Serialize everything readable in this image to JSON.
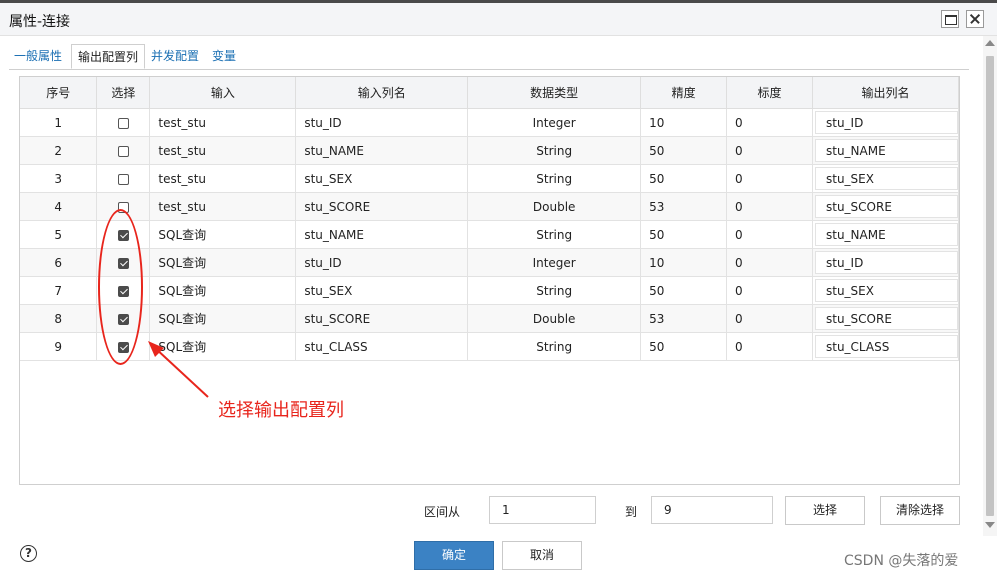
{
  "window": {
    "title": "属性-连接"
  },
  "tabs": [
    {
      "label": "一般属性",
      "active": false
    },
    {
      "label": "输出配置列",
      "active": true
    },
    {
      "label": "并发配置",
      "active": false
    },
    {
      "label": "变量",
      "active": false
    }
  ],
  "table": {
    "headers": [
      "序号",
      "选择",
      "输入",
      "输入列名",
      "数据类型",
      "精度",
      "标度",
      "输出列名"
    ],
    "rows": [
      {
        "no": "1",
        "checked": false,
        "input": "test_stu",
        "col": "stu_ID",
        "type": "Integer",
        "precision": "10",
        "scale": "0",
        "out": "stu_ID"
      },
      {
        "no": "2",
        "checked": false,
        "input": "test_stu",
        "col": "stu_NAME",
        "type": "String",
        "precision": "50",
        "scale": "0",
        "out": "stu_NAME"
      },
      {
        "no": "3",
        "checked": false,
        "input": "test_stu",
        "col": "stu_SEX",
        "type": "String",
        "precision": "50",
        "scale": "0",
        "out": "stu_SEX"
      },
      {
        "no": "4",
        "checked": false,
        "input": "test_stu",
        "col": "stu_SCORE",
        "type": "Double",
        "precision": "53",
        "scale": "0",
        "out": "stu_SCORE"
      },
      {
        "no": "5",
        "checked": true,
        "input": "SQL查询",
        "col": "stu_NAME",
        "type": "String",
        "precision": "50",
        "scale": "0",
        "out": "stu_NAME"
      },
      {
        "no": "6",
        "checked": true,
        "input": "SQL查询",
        "col": "stu_ID",
        "type": "Integer",
        "precision": "10",
        "scale": "0",
        "out": "stu_ID"
      },
      {
        "no": "7",
        "checked": true,
        "input": "SQL查询",
        "col": "stu_SEX",
        "type": "String",
        "precision": "50",
        "scale": "0",
        "out": "stu_SEX"
      },
      {
        "no": "8",
        "checked": true,
        "input": "SQL查询",
        "col": "stu_SCORE",
        "type": "Double",
        "precision": "53",
        "scale": "0",
        "out": "stu_SCORE"
      },
      {
        "no": "9",
        "checked": true,
        "input": "SQL查询",
        "col": "stu_CLASS",
        "type": "String",
        "precision": "50",
        "scale": "0",
        "out": "stu_CLASS"
      }
    ]
  },
  "annotation": {
    "text": "选择输出配置列",
    "color": "#e8251c"
  },
  "range": {
    "from_label": "区间从",
    "from_value": "1",
    "to_label": "到",
    "to_value": "9",
    "select_label": "选择",
    "clear_label": "清除选择"
  },
  "footer": {
    "ok_label": "确定",
    "cancel_label": "取消",
    "help_icon": "?",
    "watermark": "CSDN @失落的爱"
  },
  "colors": {
    "accent": "#3b82c4",
    "link": "#1a6fb3"
  }
}
